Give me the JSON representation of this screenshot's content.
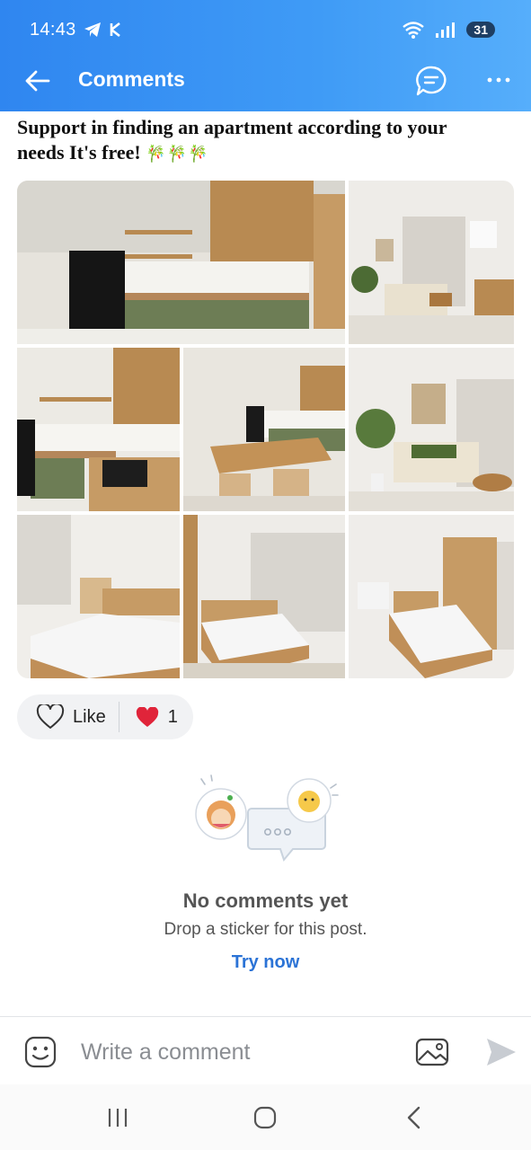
{
  "status_bar": {
    "time": "14:43",
    "battery": "31",
    "icons": [
      "telegram-icon",
      "k-app-icon",
      "wifi-icon",
      "signal-icon",
      "battery-icon"
    ]
  },
  "header": {
    "title": "Comments",
    "icons": [
      "back-arrow-icon",
      "chat-bubble-icon",
      "more-dots-icon"
    ]
  },
  "post": {
    "text_line1": "Support in finding an apartment according to your",
    "text_line2": "needs It's free!",
    "emoji": "🎋🎋🎋",
    "photos": [
      "kitchen-photo",
      "living-room-photo",
      "kitchen-closeup-photo",
      "dining-table-photo",
      "sofa-photo",
      "bedroom-photo-1",
      "bedroom-photo-2",
      "bedroom-photo-3"
    ]
  },
  "reactions": {
    "like_label": "Like",
    "count": "1",
    "reaction_icon": "heart-icon"
  },
  "empty_state": {
    "title": "No comments yet",
    "subtitle": "Drop a sticker for this post.",
    "action": "Try now"
  },
  "composer": {
    "placeholder": "Write a comment",
    "icons": [
      "sticker-smile-icon",
      "image-icon",
      "send-icon"
    ]
  },
  "colors": {
    "header_gradient_start": "#2f86f0",
    "header_gradient_end": "#56aefb",
    "link_blue": "#2b73d6",
    "heart_red": "#e0243a"
  }
}
